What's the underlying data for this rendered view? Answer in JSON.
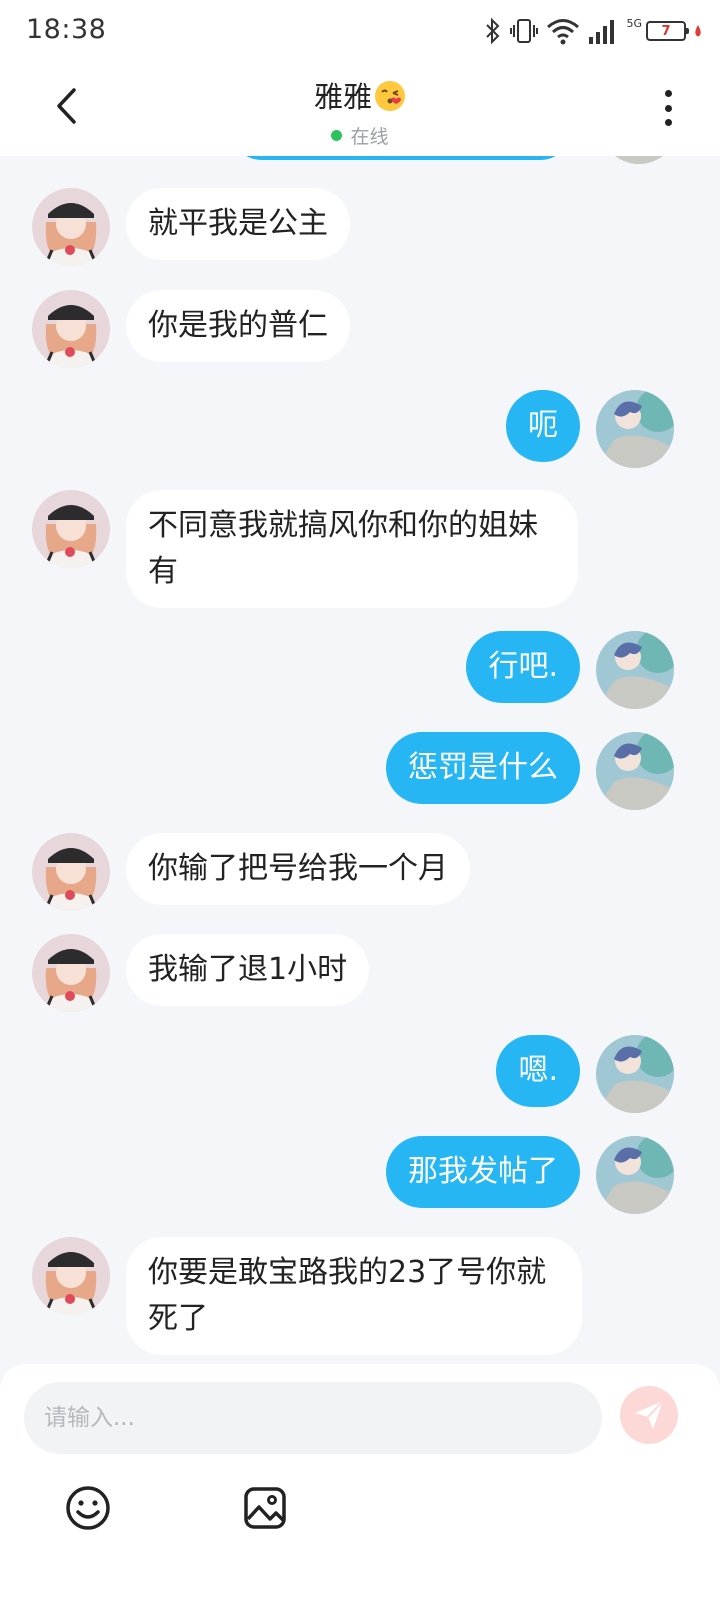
{
  "status_bar": {
    "time": "18:38",
    "network": "5G",
    "battery_level": "7",
    "icons": [
      "bluetooth-icon",
      "vibrate-icon",
      "wifi-icon",
      "signal-icon",
      "battery-icon"
    ]
  },
  "header": {
    "title": "雅雅",
    "title_emoji": "kissing-face-emoji",
    "status": "在线",
    "status_color": "#2bc35c",
    "icons": [
      "back-arrow-icon",
      "more-vertical-icon"
    ]
  },
  "colors": {
    "outgoing_bubble": "#27b6f4",
    "incoming_bubble": "#ffffff",
    "background": "#f4f6f9",
    "send_button": "#fcd9d6"
  },
  "messages": [
    {
      "sender": "contact",
      "text": "就平我是公主"
    },
    {
      "sender": "contact",
      "text": "你是我的普仁"
    },
    {
      "sender": "me",
      "text": "呃"
    },
    {
      "sender": "contact",
      "text": "不同意我就搞风你和你的姐妹有"
    },
    {
      "sender": "me",
      "text": "行吧."
    },
    {
      "sender": "me",
      "text": "惩罚是什么"
    },
    {
      "sender": "contact",
      "text": "你输了把号给我一个月"
    },
    {
      "sender": "contact",
      "text": "我输了退1小时"
    },
    {
      "sender": "me",
      "text": "嗯."
    },
    {
      "sender": "me",
      "text": "那我发帖了"
    },
    {
      "sender": "contact",
      "text": "你要是敢宝路我的23了号你就死了"
    }
  ],
  "composer": {
    "placeholder": "请输入...",
    "value": "",
    "icons": [
      "send-icon",
      "emoji-icon",
      "image-icon"
    ]
  }
}
